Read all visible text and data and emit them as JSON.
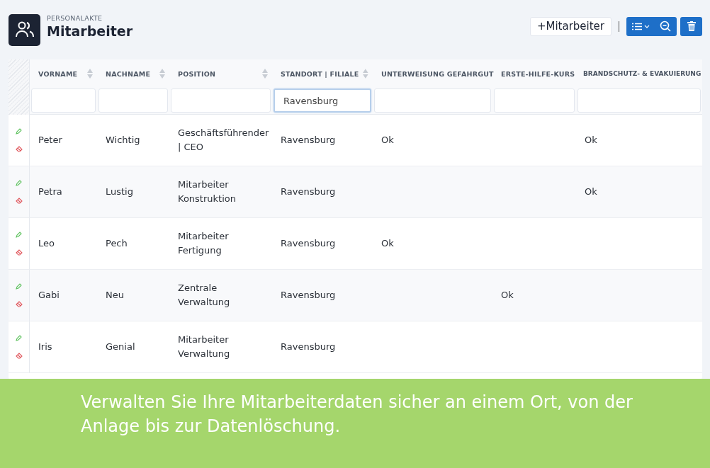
{
  "header": {
    "overline": "PERSONALAKTE",
    "title": "Mitarbeiter",
    "add_button": "+Mitarbeiter"
  },
  "table": {
    "columns": [
      {
        "label": "VORNAME",
        "sortable": true
      },
      {
        "label": "NACHNAME",
        "sortable": true
      },
      {
        "label": "POSITION",
        "sortable": true
      },
      {
        "label": "STANDORT | FILIALE",
        "sortable": true
      },
      {
        "label": "UNTERWEISUNG GEFAHRGUT",
        "sortable": false
      },
      {
        "label": "ERSTE-HILFE-KURS",
        "sortable": false
      },
      {
        "label": "BRANDSCHUTZ- & EVAKUIERUNG",
        "sortable": false
      }
    ],
    "filters": [
      {
        "focused": false
      },
      {
        "focused": false
      },
      {
        "focused": false
      },
      {
        "value": "Ravensburg",
        "focused": true
      },
      {
        "focused": false
      },
      {
        "focused": false
      },
      {
        "focused": false
      }
    ],
    "rows": [
      {
        "cells": [
          "Peter",
          "Wichtig",
          "Geschäftsführender | CEO",
          "Ravensburg",
          "Ok",
          null,
          "Ok"
        ]
      },
      {
        "cells": [
          "Petra",
          "Lustig",
          "Mitarbeiter Konstruktion",
          "Ravensburg",
          null,
          null,
          "Ok"
        ]
      },
      {
        "cells": [
          "Leo",
          "Pech",
          "Mitarbeiter Fertigung",
          "Ravensburg",
          "Ok",
          null,
          null
        ]
      },
      {
        "cells": [
          "Gabi",
          "Neu",
          "Zentrale Verwaltung",
          "Ravensburg",
          null,
          "Ok",
          null
        ]
      },
      {
        "cells": [
          "Iris",
          "Genial",
          "Mitarbeiter Verwaltung",
          "Ravensburg",
          null,
          null,
          null
        ]
      }
    ]
  },
  "banner": {
    "text": "Verwalten Sie Ihre Mitarbeiterdaten sicher an einem Ort, von der Anlage bis zur Datenlöschung."
  }
}
